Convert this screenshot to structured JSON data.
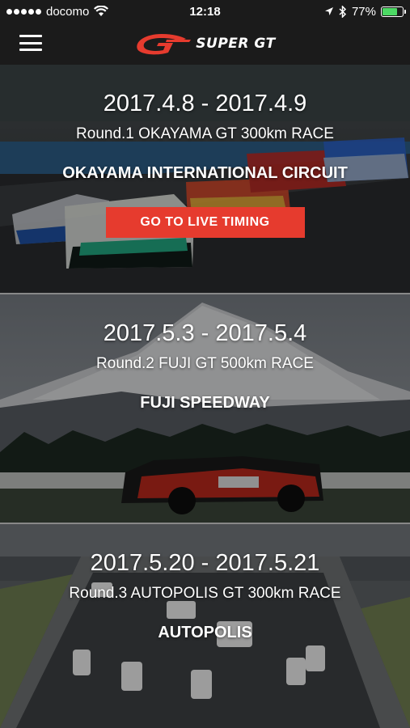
{
  "status_bar": {
    "carrier": "docomo",
    "time": "12:18",
    "battery_percent_label": "77%",
    "battery_level": 0.77
  },
  "header": {
    "logo_text": "SUPER GT"
  },
  "races": [
    {
      "dates": "2017.4.8 - 2017.4.9",
      "round": "Round.1 OKAYAMA GT 300km RACE",
      "circuit": "OKAYAMA INTERNATIONAL CIRCUIT",
      "live_timing_label": "GO TO LIVE TIMING"
    },
    {
      "dates": "2017.5.3 - 2017.5.4",
      "round": "Round.2 FUJI GT 500km RACE",
      "circuit": "FUJI SPEEDWAY"
    },
    {
      "dates": "2017.5.20 - 2017.5.21",
      "round": "Round.3 AUTOPOLIS GT 300km RACE",
      "circuit": "AUTOPOLIS"
    }
  ],
  "colors": {
    "accent": "#e63b2e",
    "header_bg": "#1b1b1b",
    "battery": "#4cd964"
  }
}
